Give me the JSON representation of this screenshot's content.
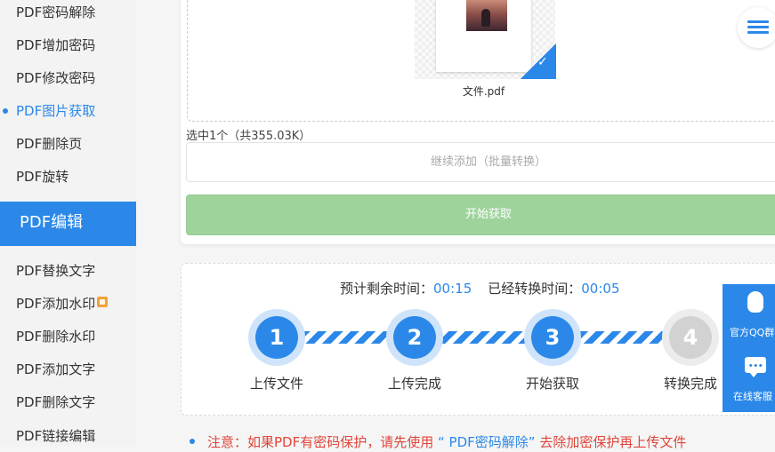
{
  "sidebar": {
    "items_top": [
      {
        "label": "PDF密码解除",
        "active": false
      },
      {
        "label": "PDF增加密码",
        "active": false
      },
      {
        "label": "PDF修改密码",
        "active": false
      },
      {
        "label": "PDF图片获取",
        "active": true
      },
      {
        "label": "PDF删除页",
        "active": false
      },
      {
        "label": "PDF旋转",
        "active": false
      }
    ],
    "section_title": "PDF编辑",
    "items_bottom": [
      {
        "label": "PDF替换文字"
      },
      {
        "label": "PDF添加水印"
      },
      {
        "label": "PDF删除水印"
      },
      {
        "label": "PDF添加文字"
      },
      {
        "label": "PDF删除文字"
      },
      {
        "label": "PDF链接编辑"
      }
    ]
  },
  "upload": {
    "file_name": "文件.pdf",
    "selected_info": "选中1个（共355.03K）",
    "add_more_label": "继续添加（批量转换）",
    "start_label": "开始获取"
  },
  "progress": {
    "remaining_label": "预计剩余时间：",
    "remaining_value": "00:15",
    "elapsed_label": "已经转换时间：",
    "elapsed_value": "00:05",
    "steps": [
      {
        "number": "1",
        "label": "上传文件",
        "done": true
      },
      {
        "number": "2",
        "label": "上传完成",
        "done": true
      },
      {
        "number": "3",
        "label": "开始获取",
        "done": true
      },
      {
        "number": "4",
        "label": "转换完成",
        "done": false
      }
    ]
  },
  "notice": {
    "prefix": "注意：如果PDF有密码保护，请先使用",
    "link": "“ PDF密码解除”",
    "suffix": "去除加密保护再上传文件"
  },
  "float_panel": {
    "qq_label": "官方QQ群",
    "service_label": "在线客服"
  },
  "colors": {
    "accent": "#2b88e8",
    "start_button": "#9fd39c",
    "warning": "#e0453a"
  },
  "icons": [
    "menu-icon",
    "check-icon",
    "qq-icon",
    "chat-icon",
    "new-badge-icon"
  ]
}
